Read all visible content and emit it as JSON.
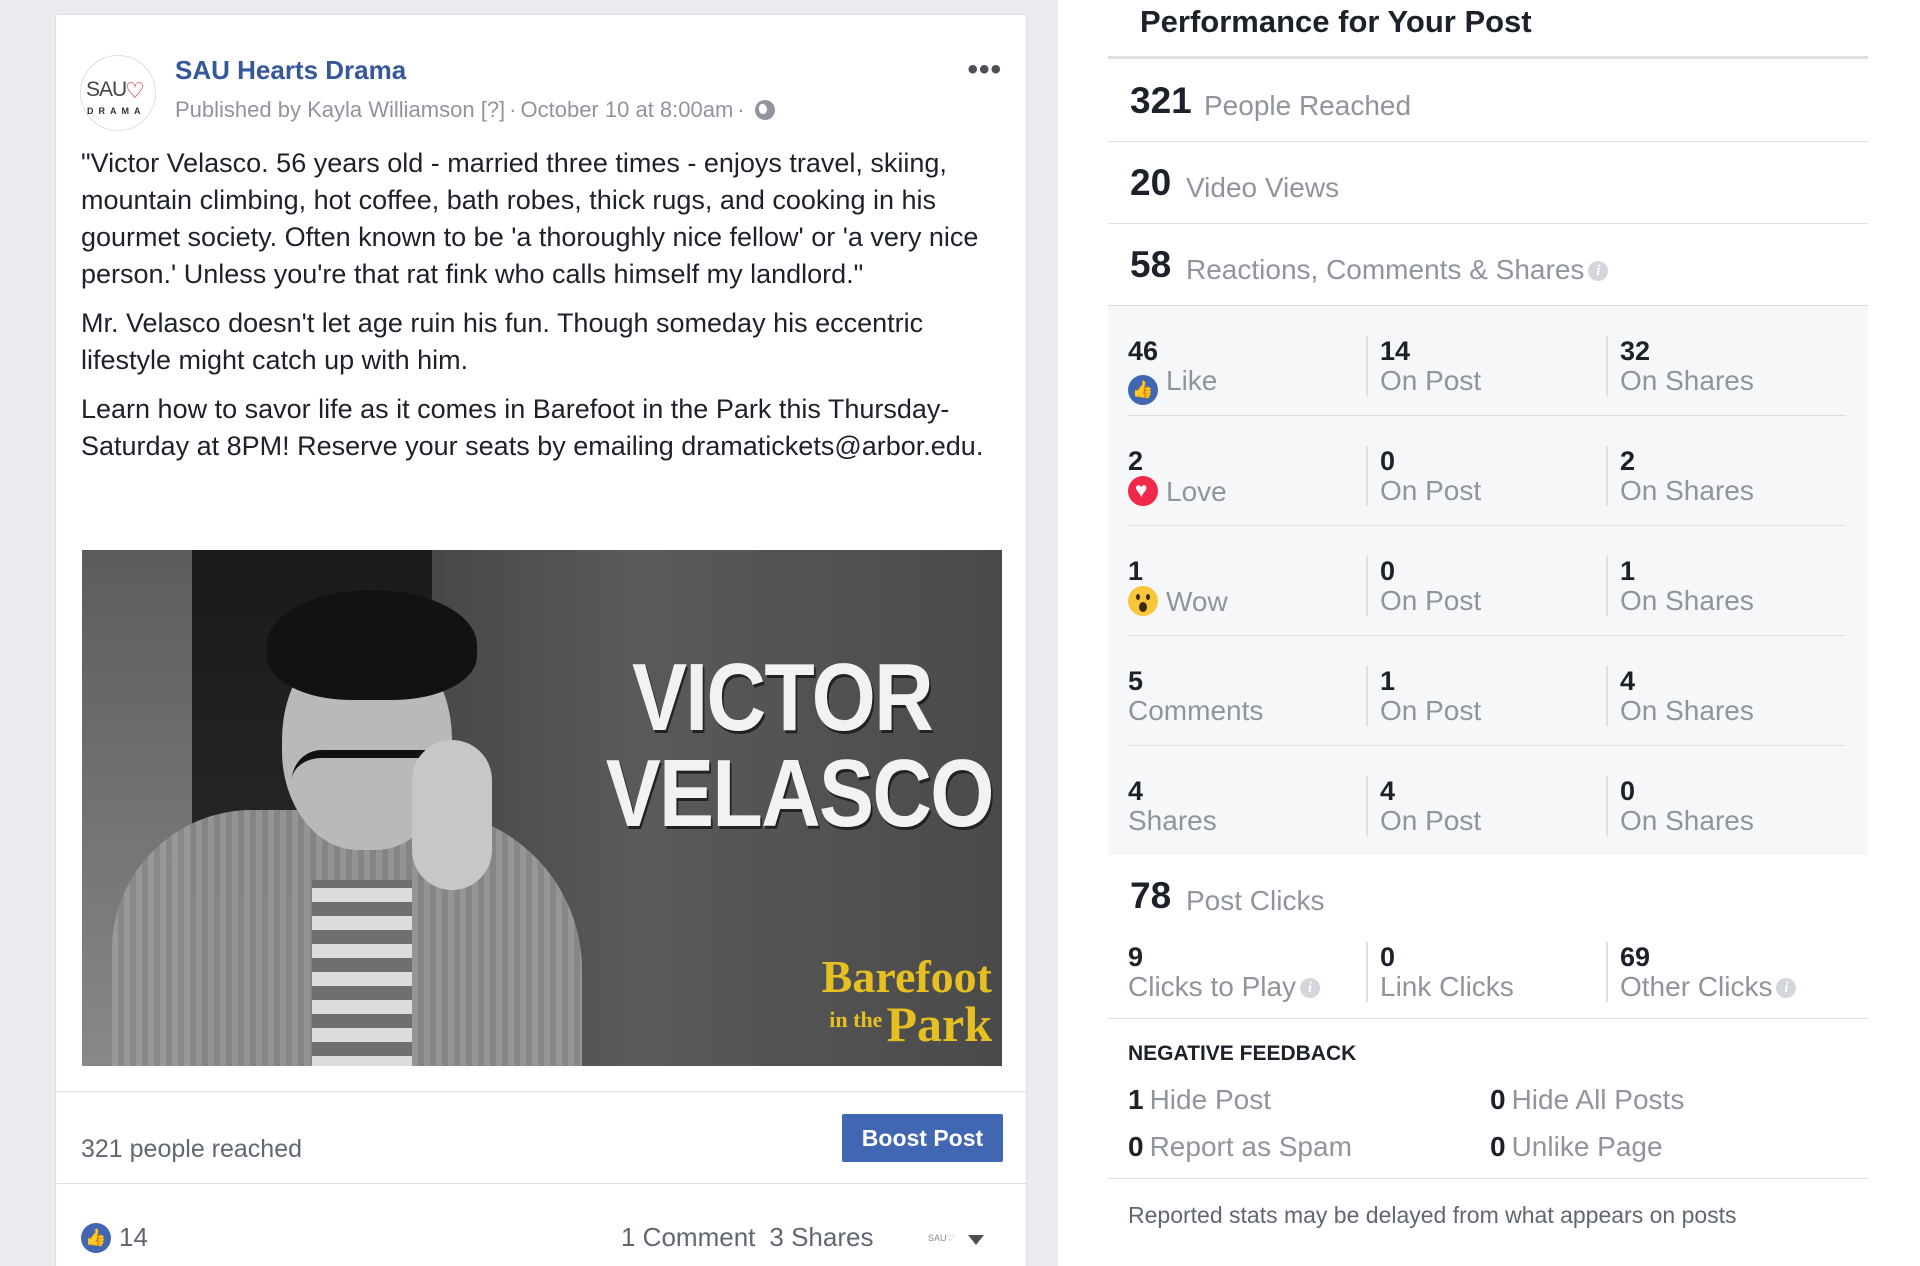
{
  "post": {
    "page_name": "SAU Hearts Drama",
    "avatar": {
      "line1": "SAU",
      "heart": "♡",
      "line2": "DRAMA"
    },
    "published_by": "Published by Kayla Williamson",
    "help_marker": "[?]",
    "date": "October 10 at 8:00am",
    "more_label": "•••",
    "paragraphs": [
      "\"Victor Velasco. 56 years old - married three times - enjoys travel, skiing, mountain climbing, hot coffee, bath robes, thick rugs, and cooking in his gourmet society. Often known to be 'a thoroughly nice fellow' or 'a very nice person.' Unless you're that rat fink who calls himself my landlord.\"",
      "Mr. Velasco doesn't let age ruin his fun. Though someday his eccentric lifestyle might catch up with him.",
      "Learn how to savor life as it comes in Barefoot in the Park this Thursday-Saturday at 8PM! Reserve your seats by emailing dramatickets@arbor.edu."
    ],
    "image": {
      "title_line1": "VICTOR",
      "title_line2": "VELASCO",
      "play_line1": "Barefoot",
      "play_small": "in the",
      "play_line2": "Park"
    },
    "reach_text": "321 people reached",
    "boost_label": "Boost Post",
    "like_count": "14",
    "comments_label": "1 Comment",
    "shares_label": "3 Shares",
    "mini_avatar": "SAU♡"
  },
  "performance": {
    "title": "Performance for Your Post",
    "people_reached": {
      "value": "321",
      "label": "People Reached"
    },
    "video_views": {
      "value": "20",
      "label": "Video Views"
    },
    "reactions_total": {
      "value": "58",
      "label": "Reactions, Comments & Shares"
    },
    "info_glyph": "i",
    "reactions": [
      {
        "total": "46",
        "label": "Like",
        "icon": "like-icon",
        "on_post": "14",
        "on_shares": "32"
      },
      {
        "total": "2",
        "label": "Love",
        "icon": "love-icon",
        "on_post": "0",
        "on_shares": "2"
      },
      {
        "total": "1",
        "label": "Wow",
        "icon": "wow-icon",
        "on_post": "0",
        "on_shares": "1"
      },
      {
        "total": "5",
        "label": "Comments",
        "icon": "",
        "on_post": "1",
        "on_shares": "4"
      },
      {
        "total": "4",
        "label": "Shares",
        "icon": "",
        "on_post": "4",
        "on_shares": "0"
      }
    ],
    "on_post_label": "On Post",
    "on_shares_label": "On Shares",
    "post_clicks": {
      "value": "78",
      "label": "Post Clicks"
    },
    "clicks": {
      "play": {
        "value": "9",
        "label": "Clicks to Play"
      },
      "link": {
        "value": "0",
        "label": "Link Clicks"
      },
      "other": {
        "value": "69",
        "label": "Other Clicks"
      }
    },
    "negative_feedback": {
      "title": "NEGATIVE FEEDBACK",
      "hide_post": {
        "value": "1",
        "label": "Hide Post"
      },
      "hide_all": {
        "value": "0",
        "label": "Hide All Posts"
      },
      "spam": {
        "value": "0",
        "label": "Report as Spam"
      },
      "unlike": {
        "value": "0",
        "label": "Unlike Page"
      }
    },
    "footer_note": "Reported stats may be delayed from what appears on posts"
  },
  "colors": {
    "link_blue": "#365899",
    "button_blue": "#4267b2",
    "love_red": "#f0284a",
    "wow_yellow": "#f7c63b",
    "play_gold": "#e6c020"
  }
}
